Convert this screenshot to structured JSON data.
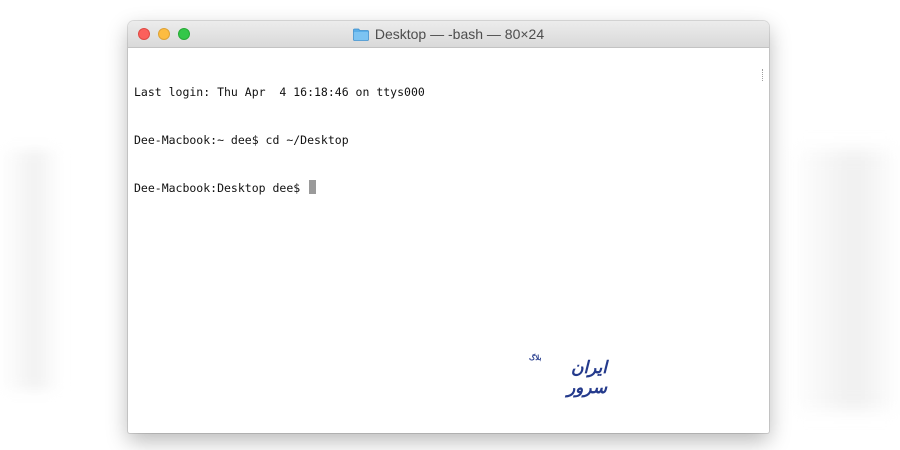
{
  "window": {
    "title": "Desktop — -bash — 80×24",
    "title_icon": "folder-icon",
    "controls": [
      "close",
      "minimize",
      "zoom"
    ]
  },
  "terminal": {
    "lines": [
      "Last login: Thu Apr  4 16:18:46 on ttys000",
      "Dee-Macbook:~ dee$ cd ~/Desktop",
      "Dee-Macbook:Desktop dee$ "
    ]
  },
  "watermark": {
    "main": "ایران سرور",
    "small": "بلاگ"
  },
  "colors": {
    "close": "#fc605c",
    "minimize": "#fdbc40",
    "zoom": "#34c749",
    "watermark": "#243a8c",
    "folder": "#5aaee8"
  }
}
